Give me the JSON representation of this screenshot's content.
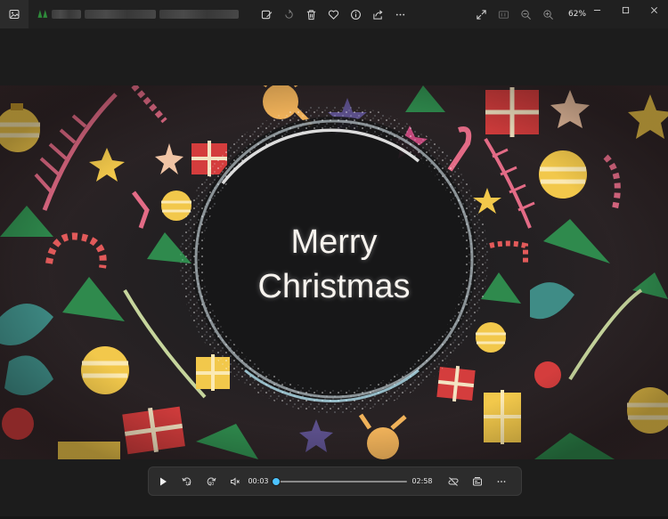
{
  "titlebar": {
    "app_icon": "photos-app-icon",
    "toolbar": [
      {
        "name": "edit-image-button",
        "icon": "edit-image-icon"
      },
      {
        "name": "rotate-button",
        "icon": "rotate-icon"
      },
      {
        "name": "delete-button",
        "icon": "trash-icon"
      },
      {
        "name": "favorite-button",
        "icon": "heart-icon"
      },
      {
        "name": "file-info-button",
        "icon": "info-icon"
      },
      {
        "name": "share-button",
        "icon": "share-icon"
      },
      {
        "name": "more-button",
        "icon": "more-icon"
      }
    ],
    "zoom_label": "62%"
  },
  "video": {
    "title_line1": "Merry",
    "title_line2": "Christmas"
  },
  "player": {
    "current_time": "00:03",
    "duration": "02:58",
    "progress": 0.017
  },
  "colors": {
    "accent": "#4cc2ff",
    "background": "#1c1c1c",
    "titlebar": "#202020",
    "player_bg": "#2c2c2c"
  }
}
